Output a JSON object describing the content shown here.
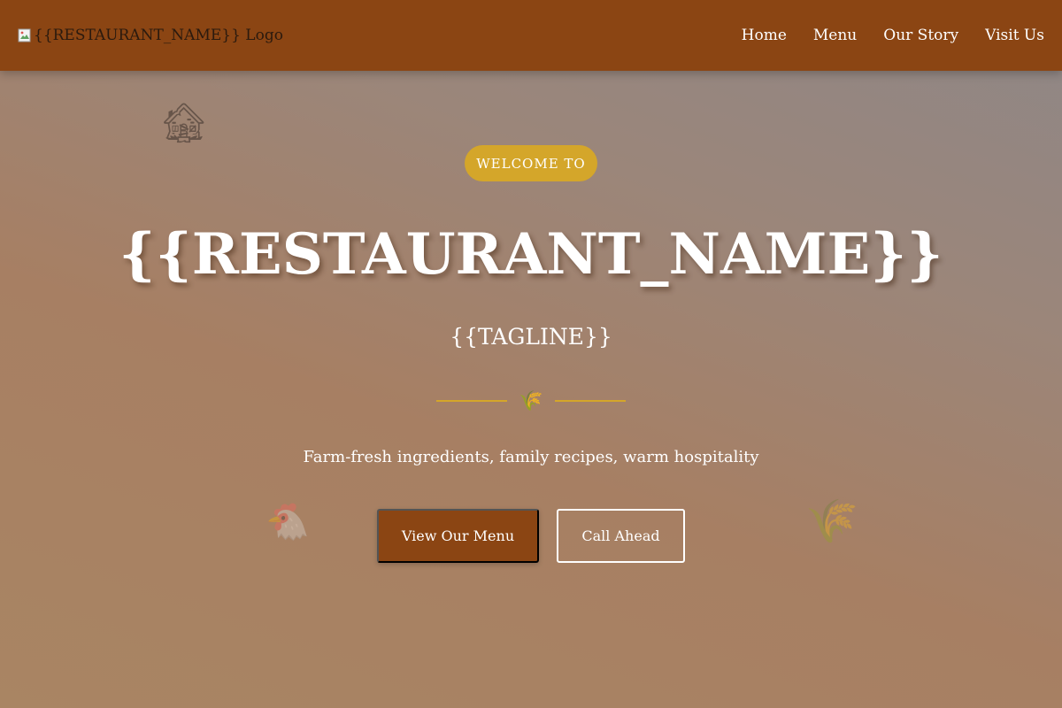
{
  "colors": {
    "nav_background": "#8b4513",
    "accent_gold": "#d4a62a",
    "primary_button": "#8b4513",
    "text_light": "#ffffff"
  },
  "header": {
    "logo_alt_text": "{{RESTAURANT_NAME}} Logo",
    "logo_icon": "broken-image-icon",
    "nav": [
      {
        "label": "Home"
      },
      {
        "label": "Menu"
      },
      {
        "label": "Our Story"
      },
      {
        "label": "Visit Us"
      }
    ]
  },
  "hero": {
    "badge": "WELCOME TO",
    "title": "{{RESTAURANT_NAME}}",
    "tagline": "{{TAGLINE}}",
    "divider_icon": "🌾",
    "description": "Farm-fresh ingredients, family recipes, warm hospitality",
    "primary_button": "View Our Menu",
    "secondary_button": "Call Ahead",
    "decorations": {
      "house": "🏚",
      "chicken": "🐔",
      "wheat": "🌾"
    }
  }
}
